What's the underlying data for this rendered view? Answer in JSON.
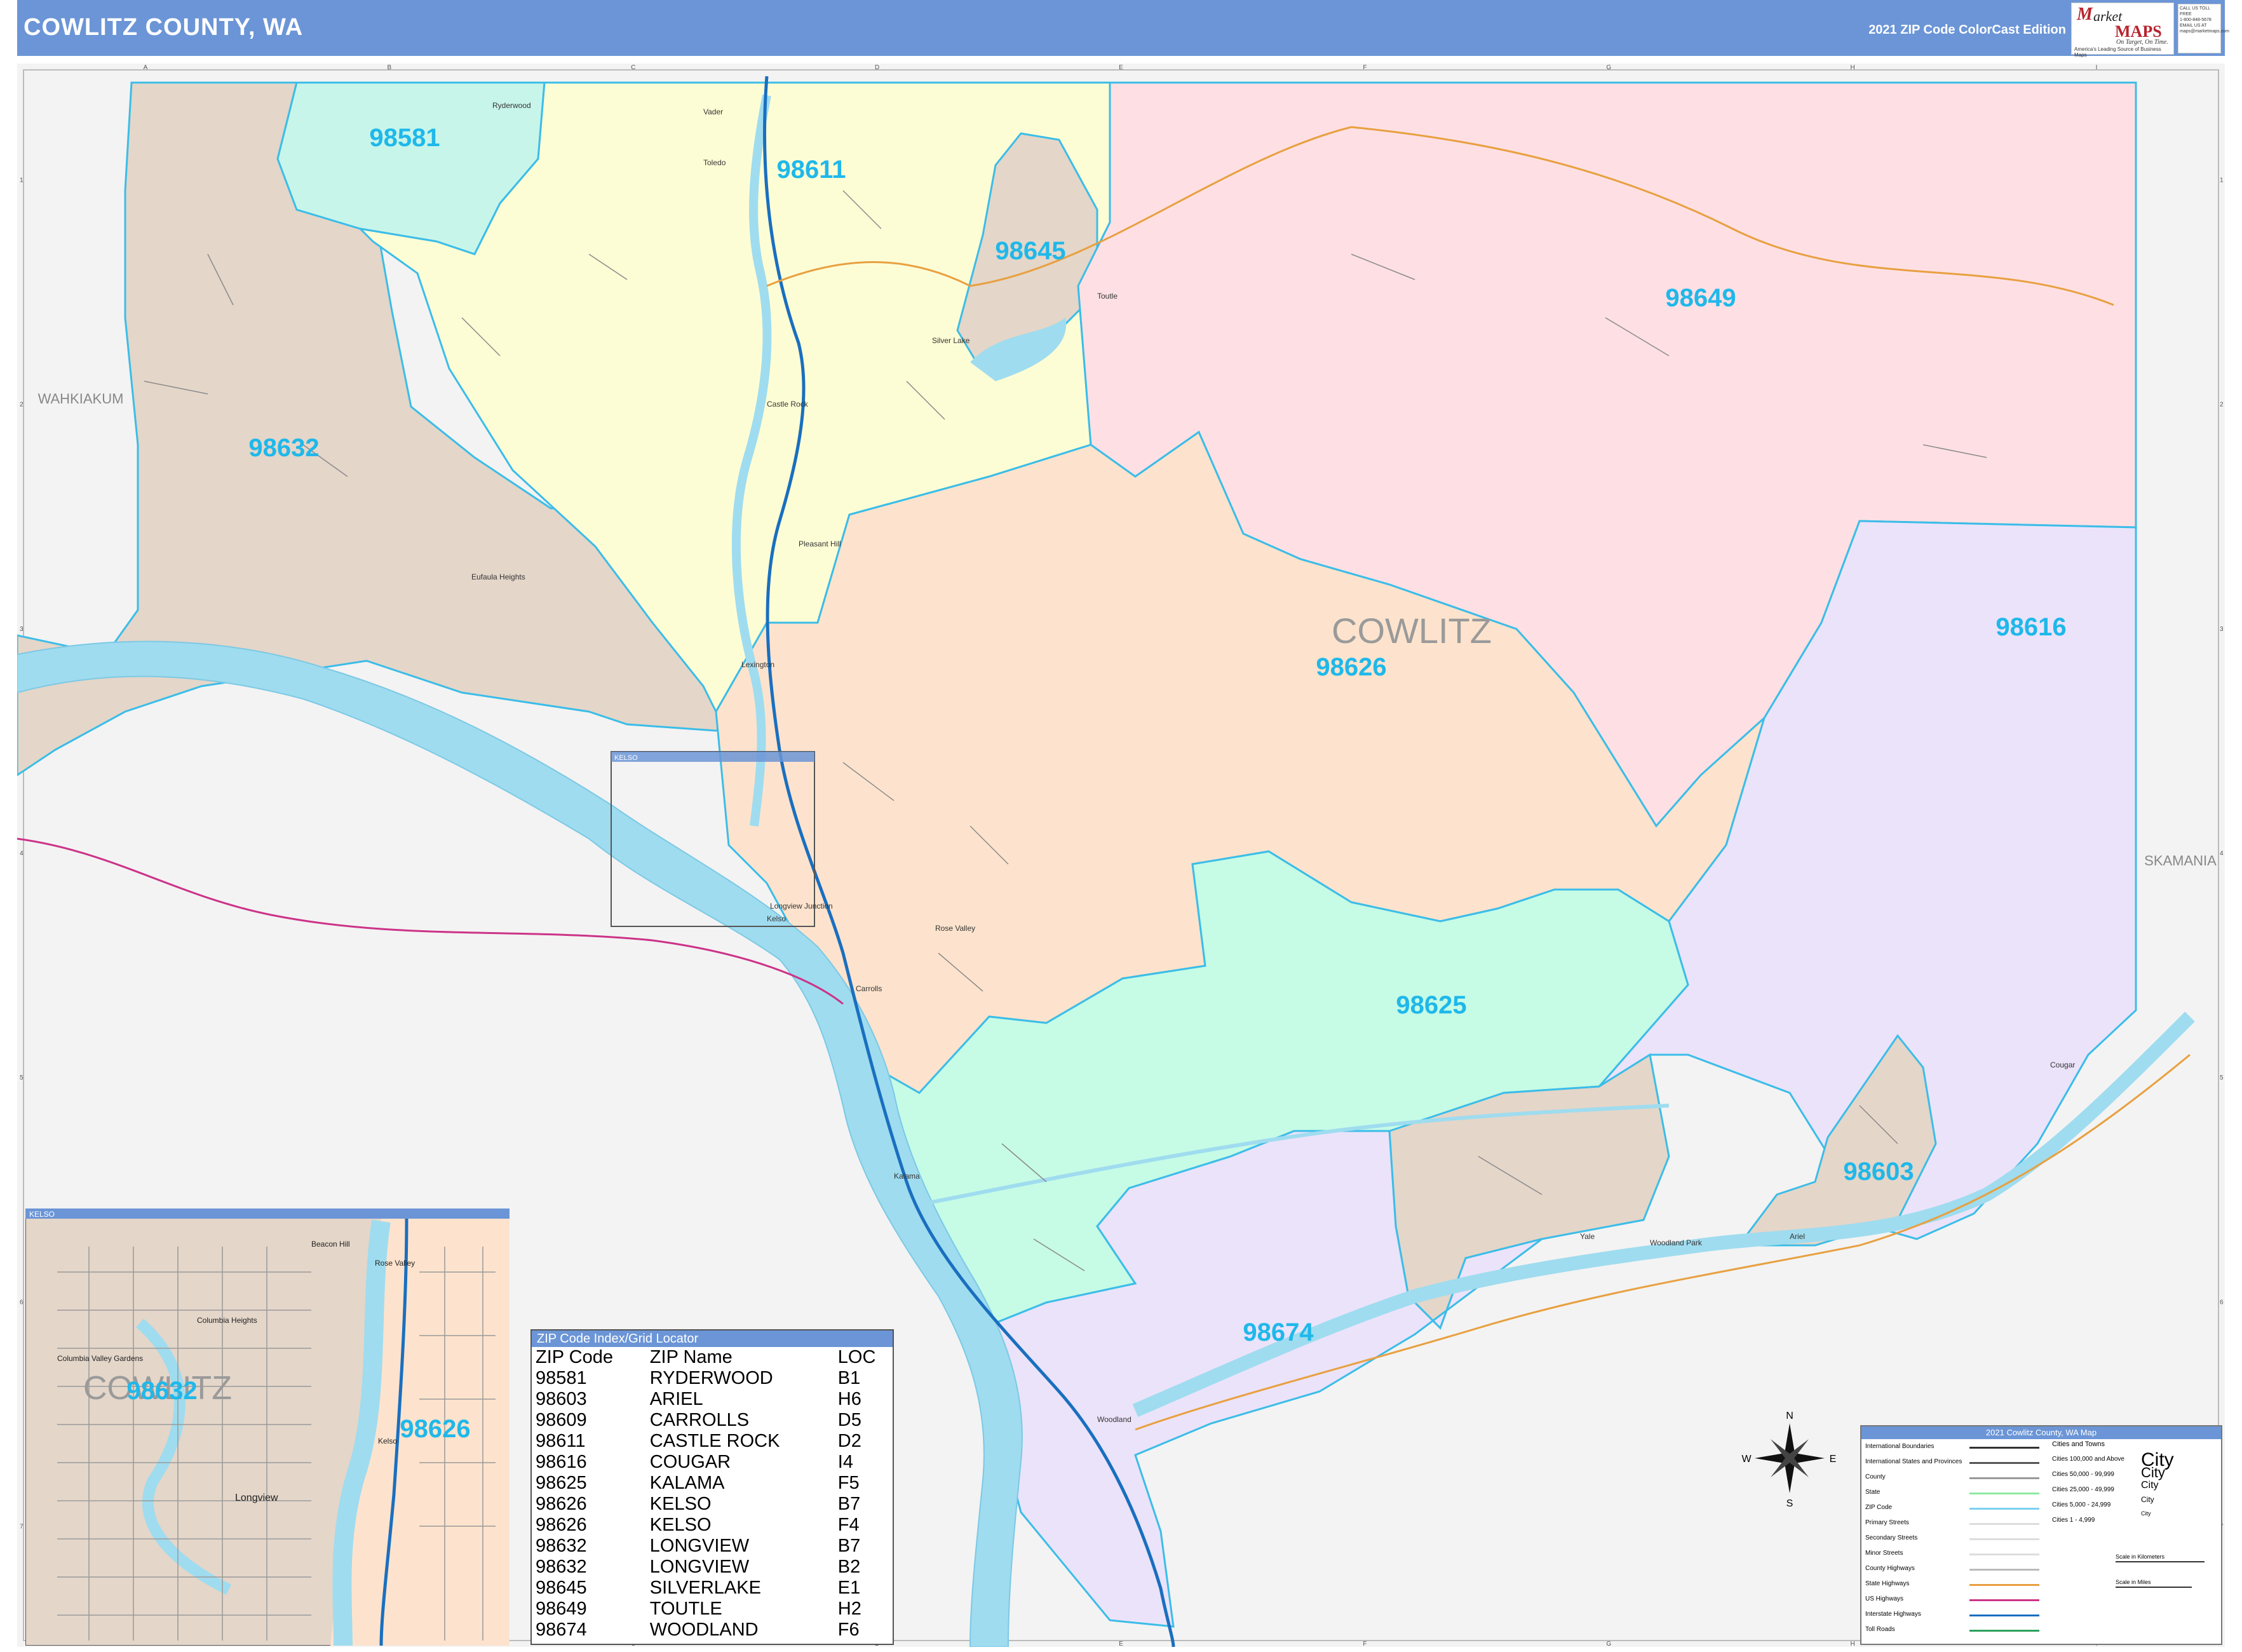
{
  "header": {
    "title": "COWLITZ COUNTY, WA",
    "edition": "2021 ZIP Code ColorCast Edition",
    "logo": {
      "word1": "M",
      "word2": "arket",
      "word3": "MAPS",
      "tagline": "On Target, On Time.",
      "subline": "America's Leading Source of Business Maps"
    },
    "contact": [
      "CALL US TOLL FREE",
      "1-800-848-5678",
      "EMAIL US AT",
      "maps@marketmaps.com"
    ]
  },
  "grid": {
    "columns": [
      "A",
      "B",
      "C",
      "D",
      "E",
      "F",
      "G",
      "H",
      "I"
    ],
    "rows": [
      "1",
      "2",
      "3",
      "4",
      "5",
      "6",
      "7"
    ]
  },
  "map": {
    "county_label": "COWLITZ",
    "neighbors": {
      "west": "WAHKIAKUM",
      "east": "SKAMANIA"
    },
    "zip_labels": [
      "98581",
      "98611",
      "98645",
      "98649",
      "98632",
      "98626",
      "98616",
      "98625",
      "98603",
      "98674"
    ],
    "towns": [
      "Ryderwood",
      "Vader",
      "Toledo",
      "Castle Rock",
      "Silver Lake",
      "Toutle",
      "Pleasant Hill",
      "Eufaula Heights",
      "Lexington",
      "Kelso",
      "Longview Junction",
      "Rose Valley",
      "Carrolls",
      "Kalama",
      "Woodland",
      "Ariel",
      "Cougar",
      "Yale",
      "Woodland Park"
    ],
    "inset_frame_label": "KELSO",
    "compass": {
      "n": "N",
      "s": "S",
      "e": "E",
      "w": "W"
    }
  },
  "inset": {
    "title": "KELSO",
    "county_label": "COWLITZ",
    "zip_labels": [
      "98632",
      "98626"
    ],
    "towns": [
      "Longview",
      "Kelso",
      "Columbia Heights",
      "Columbia Valley Gardens",
      "Beacon Hill",
      "Rose Valley"
    ]
  },
  "zip_index": {
    "title": "ZIP Code Index/Grid Locator",
    "headers": [
      "ZIP Code",
      "ZIP Name",
      "LOC"
    ],
    "rows": [
      [
        "98581",
        "RYDERWOOD",
        "B1"
      ],
      [
        "98603",
        "ARIEL",
        "H6"
      ],
      [
        "98609",
        "CARROLLS",
        "D5"
      ],
      [
        "98611",
        "CASTLE ROCK",
        "D2"
      ],
      [
        "98616",
        "COUGAR",
        "I4"
      ],
      [
        "98625",
        "KALAMA",
        "F5"
      ],
      [
        "98626",
        "KELSO",
        "B7"
      ],
      [
        "98626",
        "KELSO",
        "F4"
      ],
      [
        "98632",
        "LONGVIEW",
        "B7"
      ],
      [
        "98632",
        "LONGVIEW",
        "B2"
      ],
      [
        "98645",
        "SILVERLAKE",
        "E1"
      ],
      [
        "98649",
        "TOUTLE",
        "H2"
      ],
      [
        "98674",
        "WOODLAND",
        "F6"
      ]
    ]
  },
  "legend": {
    "title": "2021 Cowlitz County, WA Map",
    "left_items": [
      "International Boundaries",
      "International States and Provinces",
      "County",
      "State",
      "ZIP Code",
      "Primary Streets",
      "Secondary Streets",
      "Minor Streets",
      "County Highways",
      "State Highways",
      "US Highways",
      "Interstate Highways",
      "Toll Roads"
    ],
    "cities_header": "Cities and Towns",
    "city_items": [
      "Cities 100,000 and Above",
      "Cities 50,000 - 99,999",
      "Cities 25,000 - 49,999",
      "Cities 5,000 - 24,999",
      "Cities 1 - 4,999"
    ],
    "city_samples": [
      "City",
      "City",
      "City",
      "City",
      "City"
    ],
    "scale_km": "Scale in Kilometers",
    "scale_mi": "Scale in Miles"
  },
  "colors": {
    "header": "#6b95d6",
    "zip_label": "#1fb8ea",
    "water": "#9fdcef",
    "z98581": "#c8f5ea",
    "z98611": "#fdfdd5",
    "z98645": "#e4d6c9",
    "z98649": "#fee0e4",
    "z98632": "#e4d6c9",
    "z98626": "#fde3cd",
    "z98616": "#ebe3fa",
    "z98625": "#c6fbe6",
    "z98603": "#e4d6c9",
    "z98674": "#ebe3fa"
  }
}
